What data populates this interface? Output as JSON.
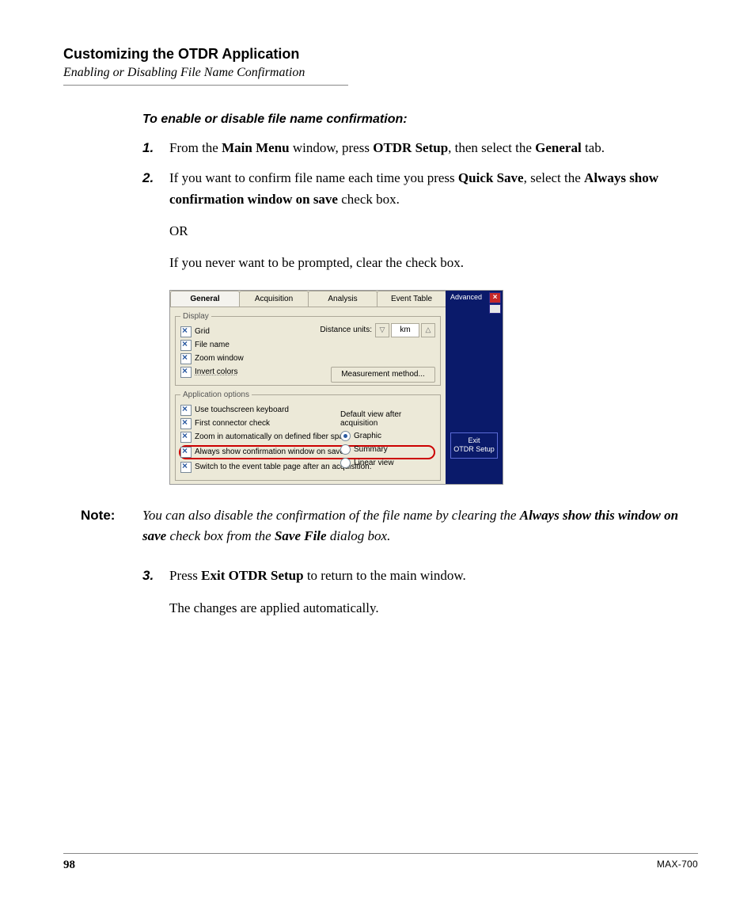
{
  "header": {
    "chapter": "Customizing the OTDR Application",
    "section": "Enabling or Disabling File Name Confirmation"
  },
  "procedure": {
    "heading": "To enable or disable file name confirmation:",
    "steps": {
      "s1_num": "1.",
      "s1_a": "From the ",
      "s1_b": "Main Menu",
      "s1_c": " window, press ",
      "s1_d": "OTDR Setup",
      "s1_e": ", then select the ",
      "s1_f": "General",
      "s1_g": " tab.",
      "s2_num": "2.",
      "s2_a": "If you want to confirm file name each time you press ",
      "s2_b": "Quick Save",
      "s2_c": ", select the ",
      "s2_d": "Always show confirmation window on save",
      "s2_e": " check box.",
      "s2_or": "OR",
      "s2_alt": "If you never want to be prompted, clear the check box.",
      "s3_num": "3.",
      "s3_a": "Press ",
      "s3_b": "Exit OTDR Setup",
      "s3_c": " to return to the main window.",
      "s3_d": "The changes are applied automatically."
    }
  },
  "note": {
    "label": "Note:",
    "a": "You can also disable the confirmation of the file name by clearing the ",
    "b": "Always show this window on save",
    "c": " check box from the ",
    "d": "Save File",
    "e": " dialog box."
  },
  "screenshot": {
    "tabs": [
      "General",
      "Acquisition",
      "Analysis",
      "Event Table"
    ],
    "display_legend": "Display",
    "app_legend": "Application options",
    "checks": {
      "grid": "Grid",
      "file_name": "File name",
      "zoom_window": "Zoom window",
      "invert_colors": "Invert colors",
      "touch_kbd": "Use touchscreen keyboard",
      "first_conn": "First connector check",
      "zoom_auto": "Zoom in automatically on defined fiber span",
      "always_confirm": "Always show confirmation window on save",
      "switch_event": "Switch to the event table page after an acquisition."
    },
    "distance_label": "Distance units:",
    "distance_value": "km",
    "meas_button": "Measurement method...",
    "default_view_label": "Default view after acquisition",
    "radios": {
      "graphic": "Graphic",
      "summary": "Summary",
      "linear": "Linear view"
    },
    "side": {
      "advanced": "Advanced",
      "exit1": "Exit",
      "exit2": "OTDR Setup"
    }
  },
  "footer": {
    "page": "98",
    "model": "MAX-700"
  }
}
